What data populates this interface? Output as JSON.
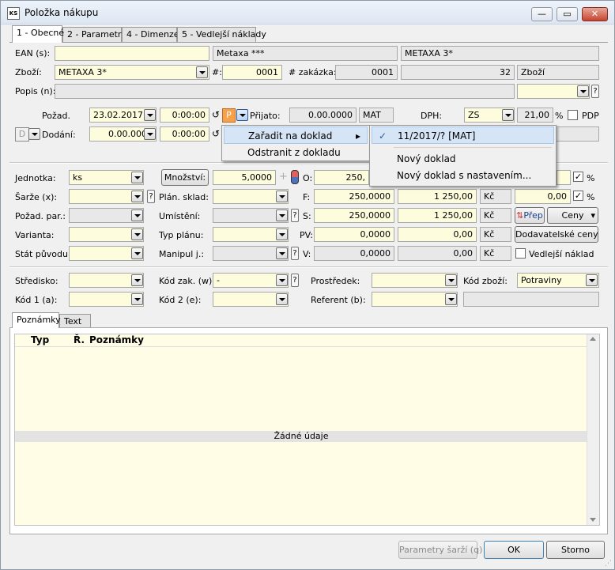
{
  "window": {
    "title": "Položka nákupu",
    "icon_text": "KS",
    "minimize": "—",
    "maximize": "▭",
    "close": "✕"
  },
  "tabs": [
    "1 - Obecné",
    "2 - Parametry",
    "4 - Dimenze",
    "5 - Vedlejší náklady"
  ],
  "ean": {
    "label": "EAN (s):",
    "value": "",
    "desc1": "Metaxa ***",
    "desc2": "METAXA 3*"
  },
  "zbozi": {
    "label": "Zboží:",
    "value": "METAXA 3*",
    "hash_label": "#:",
    "hash_value": "0001",
    "zakazka_label": "# zakázka:",
    "zakazka_value": "0001",
    "number": "32",
    "type": "Zboží"
  },
  "popis": {
    "label": "Popis (n):",
    "value": "",
    "q": "?"
  },
  "pozad": {
    "label": "Požad.",
    "date": "23.02.2017",
    "time": "0:00:00",
    "p_badge": "P",
    "prijato_label": "Přijato:",
    "prijato_value": "0.00.0000",
    "prijato_unit": "MAT",
    "dph_label": "DPH:",
    "dph_value": "ZS",
    "dph_rate": "21,00",
    "dph_pct": "%",
    "pdp_label": "PDP"
  },
  "dodani": {
    "d_badge": "D",
    "label": "Dodání:",
    "date": "0.00.0000",
    "time": "0:00:00"
  },
  "context_menu": {
    "item1": "Zařadit na doklad",
    "item2": "Odstranit z dokladu",
    "arrow": "▸"
  },
  "sub_menu": {
    "check": "✓",
    "item1": "11/2017/? [MAT]",
    "item2": "Nový doklad",
    "item3": "Nový doklad s nastavením..."
  },
  "jednotka": {
    "label": "Jednotka:",
    "value": "ks",
    "mnozstvi_btn": "Množství:",
    "mnozstvi_value": "5,0000",
    "o_label": "O:",
    "o_value1": "250,",
    "pct": "%"
  },
  "sarze": {
    "label": "Šarže (x):",
    "plan_sklad_label": "Plán. sklad:",
    "f_label": "F:",
    "f_value1": "250,0000",
    "f_value2": "1 250,00",
    "f_cur": "Kč",
    "f_value3": "0,00",
    "pct": "%",
    "q": "?"
  },
  "pozad_par": {
    "label": "Požad. par.:",
    "umisteni_label": "Umístění:",
    "s_label": "S:",
    "s_value1": "250,0000",
    "s_value2": "1 250,00",
    "s_cur": "Kč",
    "prep_btn": "Přep",
    "ceny_btn": "Ceny",
    "q": "?"
  },
  "varianta": {
    "label": "Varianta:",
    "typ_planu_label": "Typ plánu:",
    "pv_label": "PV:",
    "pv_value1": "0,0000",
    "pv_value2": "0,00",
    "pv_cur": "Kč",
    "dodavatelske_btn": "Dodavatelské ceny"
  },
  "stat": {
    "label": "Stát původu:",
    "manipul_label": "Manipul j.:",
    "v_label": "V:",
    "v_value1": "0,0000",
    "v_value2": "0,00",
    "v_cur": "Kč",
    "vedlejsi_label": "Vedlejší náklad",
    "q": "?"
  },
  "stredisko": {
    "label": "Středisko:",
    "kod_zak_label": "Kód zak. (w):",
    "kod_zak_value": "-",
    "prostredek_label": "Prostředek:",
    "kod_zbozi_label": "Kód zboží:",
    "kod_zbozi_value": "Potraviny",
    "q": "?"
  },
  "kod1": {
    "label": "Kód 1 (a):",
    "kod2_label": "Kód 2 (e):",
    "referent_label": "Referent (b):"
  },
  "notes_tabs": [
    "Poznámky",
    "Text"
  ],
  "grid": {
    "col1": "Typ",
    "col2": "Ř.",
    "col3": "Poznámky",
    "empty": "Žádné údaje"
  },
  "footer": {
    "parametry_sarzi": "Parametry šarží (q)",
    "ok": "OK",
    "storno": "Storno"
  }
}
